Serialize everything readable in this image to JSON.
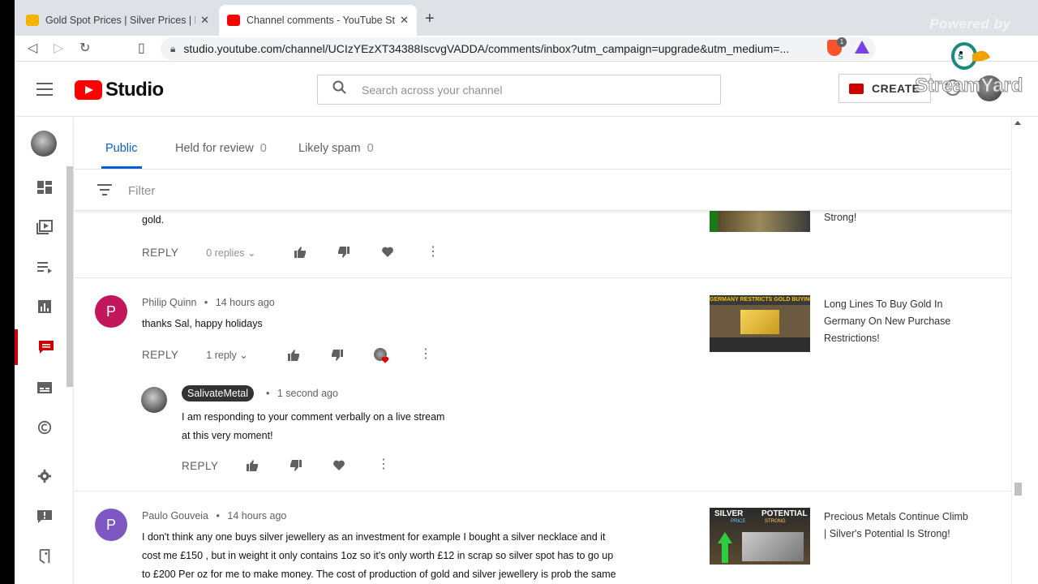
{
  "browser": {
    "tabs": [
      {
        "title": "Gold Spot Prices | Silver Prices | Pla",
        "active": false
      },
      {
        "title": "Channel comments - YouTube Stu",
        "active": true
      }
    ],
    "url": "studio.youtube.com/channel/UCIzYEzXT34388IscvgVADDA/comments/inbox?utm_campaign=upgrade&utm_medium=...",
    "brave_badge": "1"
  },
  "studio": {
    "logo_text": "Studio",
    "search_placeholder": "Search across your channel",
    "create_label": "CREATE"
  },
  "comment_tabs": [
    {
      "label": "Public",
      "count": ""
    },
    {
      "label": "Held for review",
      "count": "0"
    },
    {
      "label": "Likely spam",
      "count": "0"
    }
  ],
  "filter_label": "Filter",
  "comments": [
    {
      "text": "gold.",
      "reply_label": "REPLY",
      "replies": "0 replies",
      "video_title": "Strong!"
    },
    {
      "avatar_letter": "P",
      "avatar_color": "#c2185b",
      "author": "Philip Quinn",
      "time": "14 hours ago",
      "text": "thanks Sal, happy holidays",
      "reply_label": "REPLY",
      "replies": "1 reply",
      "video_title": "Long Lines To Buy Gold In Germany On New Purchase Restrictions!",
      "thumb_text": "GERMANY RESTRICTS GOLD BUYING"
    },
    {
      "author": "SalivateMetal",
      "time": "1 second ago",
      "text_line1": "I am responding to your comment verbally on a live stream",
      "text_line2": "at this very moment!",
      "reply_label": "REPLY"
    },
    {
      "avatar_letter": "P",
      "avatar_color": "#7e57c2",
      "author": "Paulo Gouveia",
      "time": "14 hours ago",
      "text_line1": "I don't think any one buys silver jewellery as an investment for example I bought a silver necklace and it",
      "text_line2": "cost me £150 , but in weight it only contains 1oz so it's only worth £12 in scrap so silver spot has to go up",
      "text_line3": "to £200 Per oz for me to make money. The cost of production of gold and silver jewellery is prob the same",
      "video_title": "Precious Metals Continue Climb | Silver's Potential Is Strong!",
      "thumb_left": "SILVER",
      "thumb_right": "POTENTIAL",
      "thumb_price": "PRICE",
      "thumb_strong": "STRONG"
    }
  ],
  "overlay": {
    "powered_by": "Powered by",
    "brand": "StreamYard"
  },
  "colors": {
    "accent_blue": "#065fd4",
    "youtube_red": "#ff0000"
  }
}
